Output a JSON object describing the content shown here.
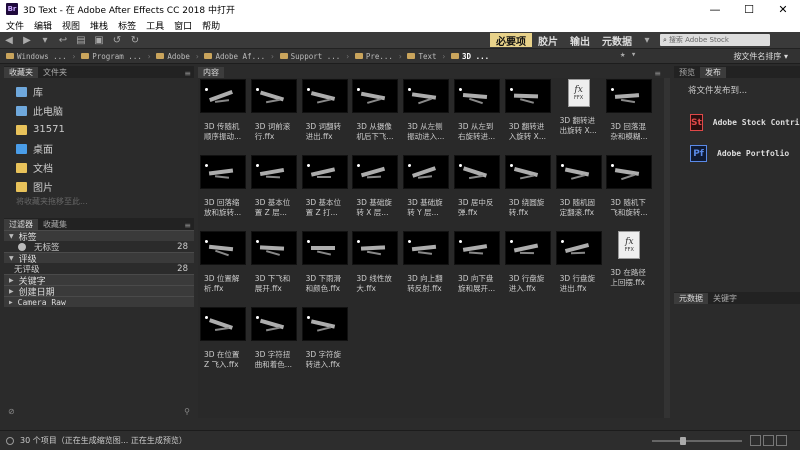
{
  "window": {
    "title": "3D Text - 在 Adobe After Effects CC 2018 中打开",
    "app_icon": "Br",
    "minimize": "—",
    "maximize": "☐",
    "close": "✕"
  },
  "menu": [
    "文件",
    "编辑",
    "视图",
    "堆栈",
    "标签",
    "工具",
    "窗口",
    "帮助"
  ],
  "workspaces": {
    "items": [
      "必要项",
      "胶片",
      "输出",
      "元数据"
    ],
    "active": "必要项",
    "dropdown": "▾"
  },
  "search": {
    "placeholder": "搜索 Adobe Stock",
    "icon": "search-icon"
  },
  "breadcrumbs": [
    "Windows ...",
    "Program ...",
    "Adobe",
    "Adobe Af...",
    "Support ...",
    "Pre...",
    "Text",
    "3D ..."
  ],
  "sort": {
    "label": "按文件名排序 ▾"
  },
  "left": {
    "fav_tabs": [
      "收藏夹",
      "文件夹"
    ],
    "favorites": [
      {
        "label": "库",
        "color": "#6fa8dc"
      },
      {
        "label": "此电脑",
        "color": "#6fa8dc"
      },
      {
        "label": "31571",
        "color": "#e8c25a"
      },
      {
        "label": "桌面",
        "color": "#4a9de8"
      },
      {
        "label": "文档",
        "color": "#e8c25a"
      },
      {
        "label": "图片",
        "color": "#e8c25a"
      }
    ],
    "fav_hint": "将收藏夹拖移至此...",
    "filter_tabs": [
      "过滤器",
      "收藏集"
    ],
    "filters": [
      {
        "head": "标签",
        "rows": [
          {
            "label": "无标签",
            "count": "28"
          }
        ]
      },
      {
        "head": "评级",
        "rows": [
          {
            "label": "无评级",
            "count": "28"
          }
        ]
      },
      {
        "head": "关键字",
        "rows": []
      },
      {
        "head": "创建日期",
        "rows": []
      },
      {
        "head": "Camera Raw",
        "rows": []
      }
    ]
  },
  "content": {
    "tab": "内容",
    "items": [
      "3D 传随机\n顺序振动...",
      "3D 词前滚\n行.ffx",
      "3D 词翻转\n进出.ffx",
      "3D 从摄像\n机后下飞...",
      "3D 从左侧\n振动进入...",
      "3D 从左到\n右旋转进...",
      "3D 翻转进\n入旋转 X...",
      "3D 翻转进\n出旋转 X...",
      "3D 回落混\n杂和模糊...",
      "3D 回落缩\n放和旋转...",
      "3D 基本位\n置 Z 层...",
      "3D 基本位\n置 Z 打...",
      "3D 基础旋\n转 X 层...",
      "3D 基础旋\n转 Y 层...",
      "3D 居中反\n弹.ffx",
      "3D 绕圆旋\n转.ffx",
      "3D 随机固\n定翻滚.ffx",
      "3D 随机下\n飞和旋转...",
      "3D 位置解\n析.ffx",
      "3D 下飞和\n展开.ffx",
      "3D 下雨滑\n和颜色.ffx",
      "3D 线性放\n大.ffx",
      "3D 向上翻\n转反射.ffx",
      "3D 向下盘\n旋和展开...",
      "3D 行盘旋\n进入.ffx",
      "3D 行盘旋\n进出.ffx",
      "3D 在路径\n上回摆.ffx",
      "3D 在位置\nZ 飞入.ffx",
      "3D 字符扭\n曲和着色...",
      "3D 字符旋\n转进入.ffx"
    ],
    "ffx_badge": "fx",
    "ffx_ext": "FFX"
  },
  "right": {
    "top_tabs": [
      "预览",
      "发布"
    ],
    "publish_to": "将文件发布到...",
    "services": [
      {
        "logo": "St",
        "name": "Adobe Stock Contrib",
        "color": "#e04848",
        "bg": "#2a0f0f"
      },
      {
        "logo": "Pf",
        "name": "Adobe Portfolio",
        "color": "#5a8ae8",
        "bg": "#0f1a33"
      }
    ],
    "bottom_tabs": [
      "元数据",
      "关键字"
    ]
  },
  "status": {
    "text": "30 个项目（正在生成缩览图... 正在生成预览）"
  },
  "icons": [
    "back-arrow-icon",
    "forward-arrow-icon",
    "refine-icon",
    "reveal-icon",
    "camera-icon",
    "rotate-left-icon",
    "rotate-right-icon",
    "search-icon",
    "folder-icon",
    "star-icon",
    "panel-menu-icon"
  ]
}
